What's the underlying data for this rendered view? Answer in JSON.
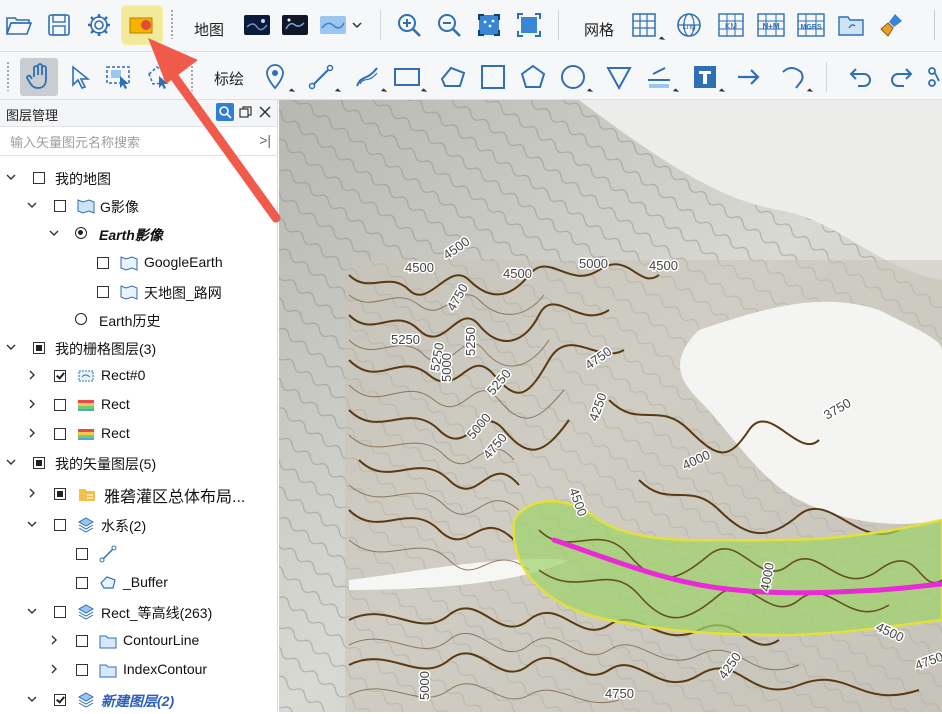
{
  "toolbar1": {
    "map_label": "地图",
    "grid_label": "网格",
    "lng_label": "Lng",
    "km_label": "KM",
    "nm_label": "N+M",
    "mgrs_label": "MGRS",
    "icons": [
      "folder-open-icon",
      "save-icon",
      "settings-icon",
      "highlighted-layer-icon",
      "map-tile-night-icon",
      "map-tile-earth-icon",
      "map-source-dropdown-icon",
      "zoom-in-icon",
      "zoom-out-icon",
      "zoom-selection-icon",
      "full-extent-icon",
      "grid-icon",
      "lng-globe-icon",
      "km-grid-icon",
      "nm-grid-icon",
      "mgrs-grid-icon",
      "folder-export-icon",
      "brush-icon"
    ]
  },
  "toolbar2": {
    "annotate_label": "标绘",
    "icons": [
      "pan-hand-icon",
      "select-arrow-icon",
      "select-box-icon",
      "select-polygon-icon",
      "placemark-icon",
      "line-icon",
      "curve-icon",
      "rectangle-icon",
      "polygon-icon",
      "square-icon",
      "pentagon-icon",
      "circle-icon",
      "cone-icon",
      "measure-icon",
      "text-icon",
      "arrow-icon",
      "hook-icon",
      "undo-icon",
      "redo-icon",
      "more-icon"
    ]
  },
  "panel": {
    "title": "图层管理",
    "search_placeholder": "输入矢量图元名称搜索",
    "search_button": ">|"
  },
  "tree": [
    {
      "label": "我的地图"
    },
    {
      "label": "G影像"
    },
    {
      "label": "Earth影像"
    },
    {
      "label": "GoogleEarth"
    },
    {
      "label": "天地图_路网"
    },
    {
      "label": "Earth历史"
    },
    {
      "label": "我的栅格图层(3)"
    },
    {
      "label": "Rect#0"
    },
    {
      "label": "Rect"
    },
    {
      "label": "Rect"
    },
    {
      "label": "我的矢量图层(5)"
    },
    {
      "label": "雅砻灌区总体布局..."
    },
    {
      "label": "水系(2)"
    },
    {
      "label": ""
    },
    {
      "label": "_Buffer"
    },
    {
      "label": "Rect_等高线(263)"
    },
    {
      "label": "ContourLine"
    },
    {
      "label": "IndexContour"
    },
    {
      "label": "新建图层(2)"
    }
  ],
  "map": {
    "contour_labels": [
      "4500",
      "4500",
      "4500",
      "5000",
      "4500",
      "4750",
      "5250",
      "5250",
      "5000",
      "5250",
      "5250",
      "4750",
      "4250",
      "5000",
      "4750",
      "4000",
      "4500",
      "3750",
      "4000",
      "4500",
      "4750",
      "4250",
      "4750",
      "5000"
    ]
  },
  "colors": {
    "contour_index": "#5a3a12",
    "buffer_fill": "#9fd36a",
    "buffer_edge": "#e4e03a",
    "river": "#e82bd6",
    "annotation_arrow": "#f05a4a"
  }
}
